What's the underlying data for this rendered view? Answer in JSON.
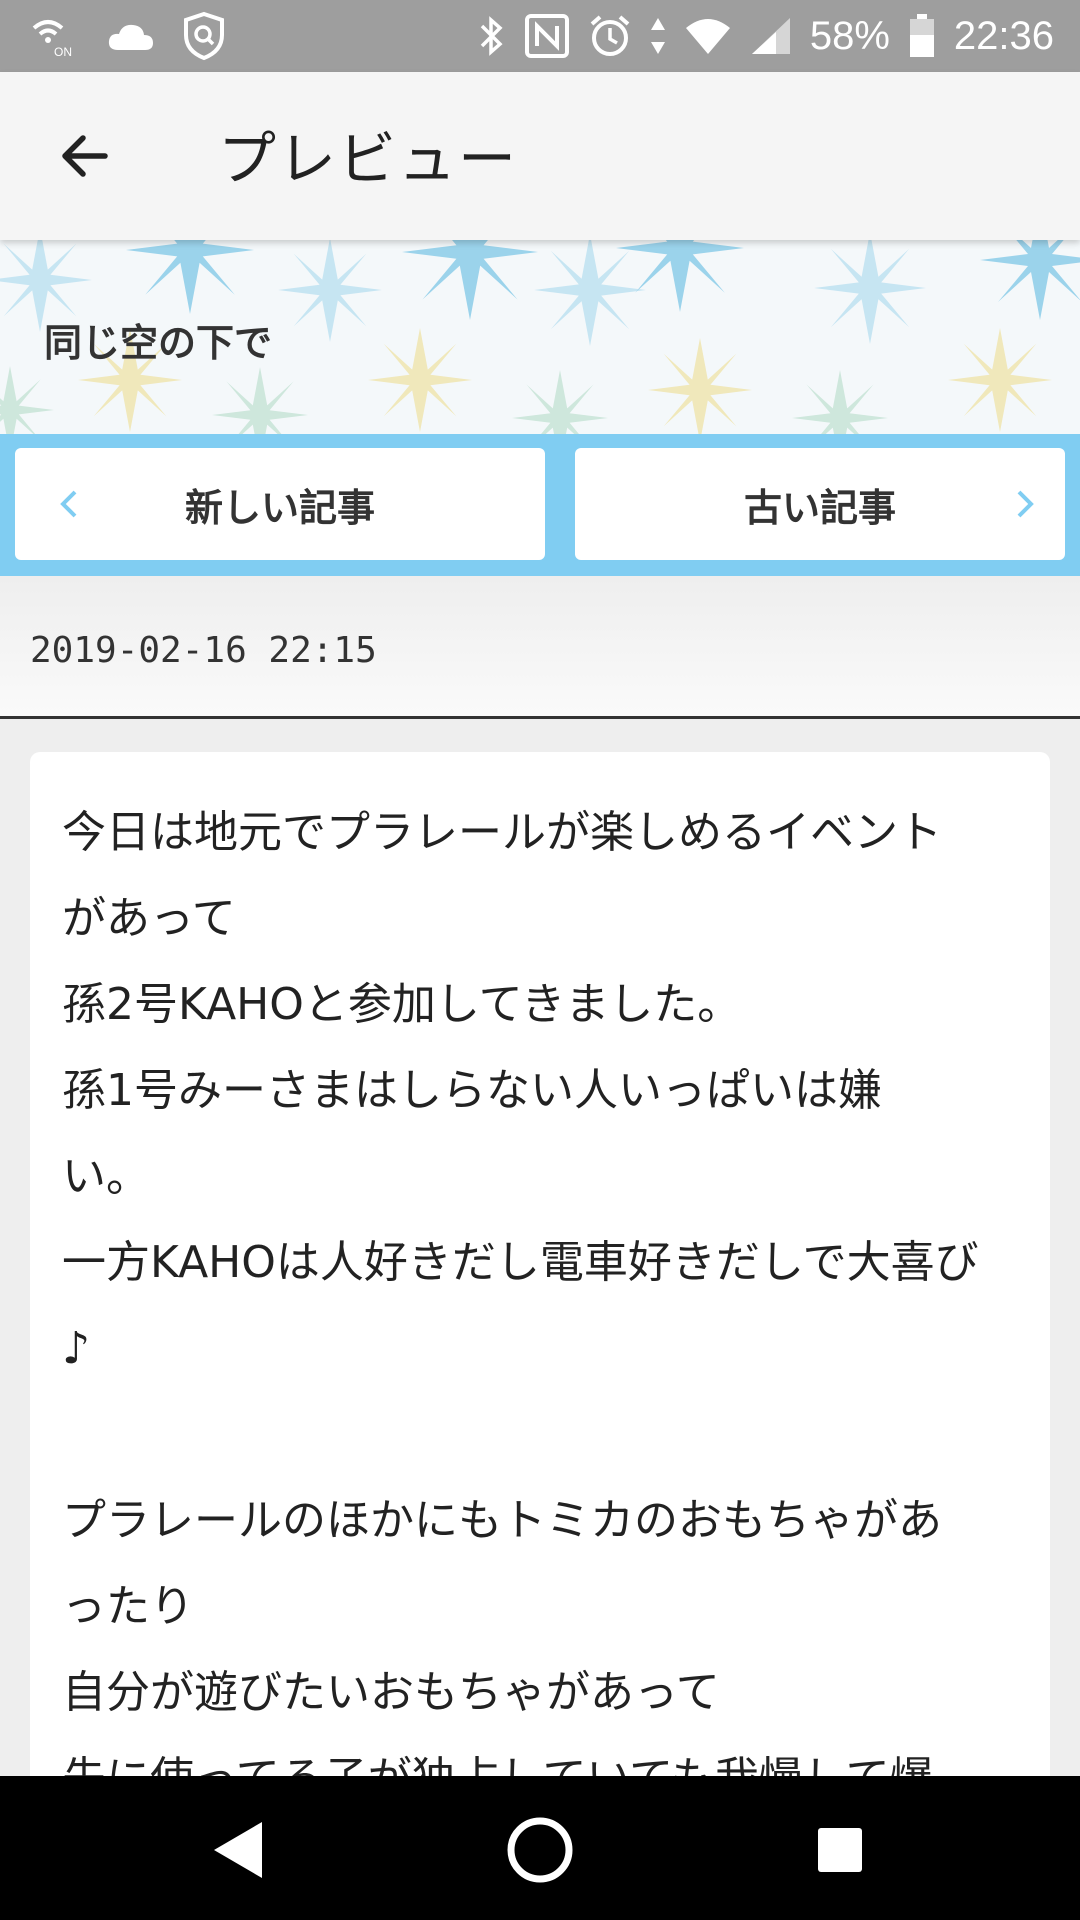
{
  "status_bar": {
    "battery": "58%",
    "time": "22:36",
    "icons_left": [
      "wifi-calling-icon",
      "cloud-icon",
      "shield-search-icon"
    ],
    "icons_right": [
      "bluetooth-icon",
      "nfc-icon",
      "alarm-icon",
      "data-arrows-icon",
      "wifi-icon",
      "signal-icon",
      "battery-icon"
    ]
  },
  "app_bar": {
    "title": "プレビュー",
    "back_icon": "arrow-back-icon"
  },
  "blog": {
    "title": "同じ空の下で"
  },
  "navigation": {
    "newer_label": "新しい記事",
    "older_label": "古い記事",
    "accent_color": "#80cdf2"
  },
  "post": {
    "datetime": "2019-02-16  22:15",
    "lines": [
      "今日は地元でプラレールが楽しめるイベント",
      "があって",
      "孫2号KAHOと参加してきました。",
      "孫1号みーさまはしらない人いっぱいは嫌",
      "い。",
      "一方KAHOは人好きだし電車好きだしで大喜び",
      "♪",
      "",
      "プラレールのほかにもトミカのおもちゃがあ",
      "ったり",
      "自分が遊びたいおもちゃがあって",
      "先に使ってる子が独占していても我慢して爆"
    ]
  },
  "system_nav": {
    "back": "back-triangle-icon",
    "home": "home-circle-icon",
    "recents": "recents-square-icon"
  }
}
